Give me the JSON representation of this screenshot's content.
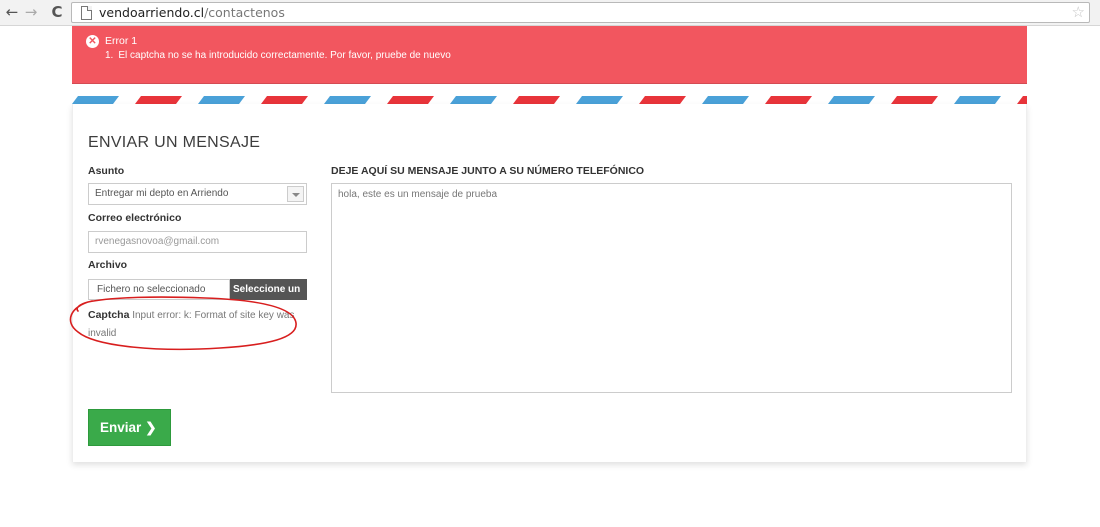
{
  "browser": {
    "url_domain": "vendoarriendo.cl",
    "url_path": "/contactenos",
    "back_glyph": "←",
    "forward_glyph": "→",
    "reload_glyph": "C",
    "star_glyph": "☆"
  },
  "error": {
    "icon_glyph": "✕",
    "title": "Error 1",
    "item_number": "1.",
    "message": "El captcha no se ha introducido correctamente. Por favor, pruebe de nuevo",
    "color": "#f2565f"
  },
  "stripe_colors": [
    "#e8343a",
    "#4aa1d8"
  ],
  "form": {
    "title": "ENVIAR UN MENSAJE",
    "subject_label": "Asunto",
    "subject_value": "Entregar mi depto en Arriendo",
    "email_label": "Correo electrónico",
    "email_value": "rvenegasnovoa@gmail.com",
    "file_label": "Archivo",
    "file_status": "Fichero no seleccionado",
    "file_button": "Seleccione un",
    "captcha_label": "Captcha",
    "captcha_error": "Input error: k: Format of site key was invalid",
    "message_label": "DEJE AQUÍ SU MENSAJE JUNTO A SU NÚMERO TELEFÓNICO",
    "message_value": "hola, este es un mensaje de prueba",
    "send_label": "Enviar",
    "send_chevron": "❯",
    "send_color": "#3aaa4a"
  },
  "annotation_color": "#d81e1e"
}
